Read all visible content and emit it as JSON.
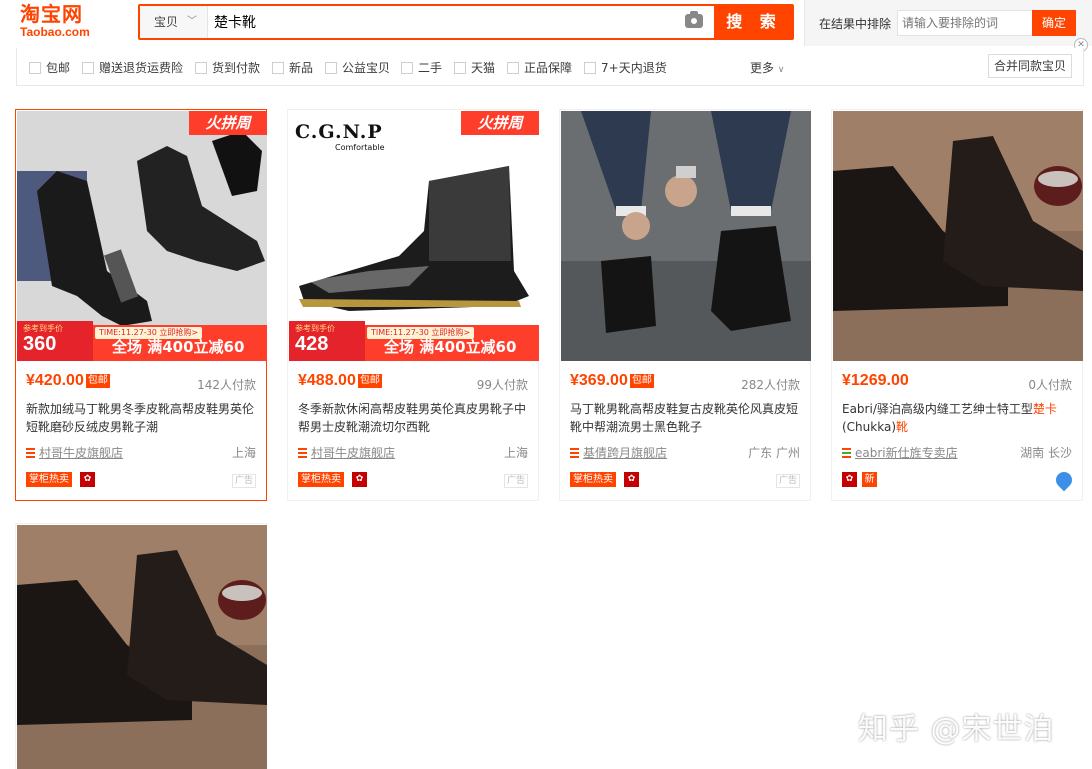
{
  "logo": {
    "cn": "淘宝网",
    "en": "Taobao.com"
  },
  "search": {
    "category": "宝贝",
    "query": "楚卡靴",
    "button": "搜 索"
  },
  "exclude": {
    "label": "在结果中排除",
    "placeholder": "请输入要排除的词",
    "button": "确定"
  },
  "filters": [
    "包邮",
    "赠送退货运费险",
    "货到付款",
    "新品",
    "公益宝贝",
    "二手",
    "天猫",
    "正品保障",
    "7+天内退货"
  ],
  "more": "更多",
  "merge_button": "合并同款宝贝",
  "colors": {
    "accent": "#ff4400"
  },
  "products": [
    {
      "price": "¥420.00",
      "baoyou": "包邮",
      "sales": "142人付款",
      "title": "新款加绒马丁靴男冬季皮靴高帮皮鞋男英伦短靴磨砂反绒皮男靴子潮",
      "shop": "村哥牛皮旗舰店",
      "location": "上海",
      "hot_tag": "掌柜热卖",
      "ad": "广告",
      "promo": {
        "tag": "火拼周",
        "ref": "参考到手价",
        "price": "360",
        "time": "TIME:11.27-30 立即抢购>",
        "text": "全场 满400立减60"
      }
    },
    {
      "price": "¥488.00",
      "baoyou": "包邮",
      "sales": "99人付款",
      "title": "冬季新款休闲高帮皮鞋男英伦真皮男靴子中帮男士皮靴潮流切尔西靴",
      "shop": "村哥牛皮旗舰店",
      "location": "上海",
      "hot_tag": "掌柜热卖",
      "ad": "广告",
      "brand": {
        "name": "C.G.N.P",
        "sub": "Comfortable"
      },
      "promo": {
        "tag": "火拼周",
        "ref": "参考到手价",
        "price": "428",
        "time": "TIME:11.27-30 立即抢购>",
        "text": "全场 满400立减60"
      }
    },
    {
      "price": "¥369.00",
      "baoyou": "包邮",
      "sales": "282人付款",
      "title": "马丁靴男靴高帮皮鞋复古皮靴英伦风真皮短靴中帮潮流男士黑色靴子",
      "shop": "基倩跨月旗舰店",
      "location": "广东 广州",
      "hot_tag": "掌柜热卖",
      "ad": "广告"
    },
    {
      "price": "¥1269.00",
      "sales": "0人付款",
      "title_pre": "Eabri/驿泊高级内缝工艺绅士特工型",
      "title_hl1": "楚卡",
      "title_mid": "(Chukka)",
      "title_hl2": "靴",
      "shop": "eabri新仕旌专卖店",
      "location": "湖南 长沙",
      "new_tag": "新"
    }
  ],
  "watermark": "知乎 @宋世泊"
}
